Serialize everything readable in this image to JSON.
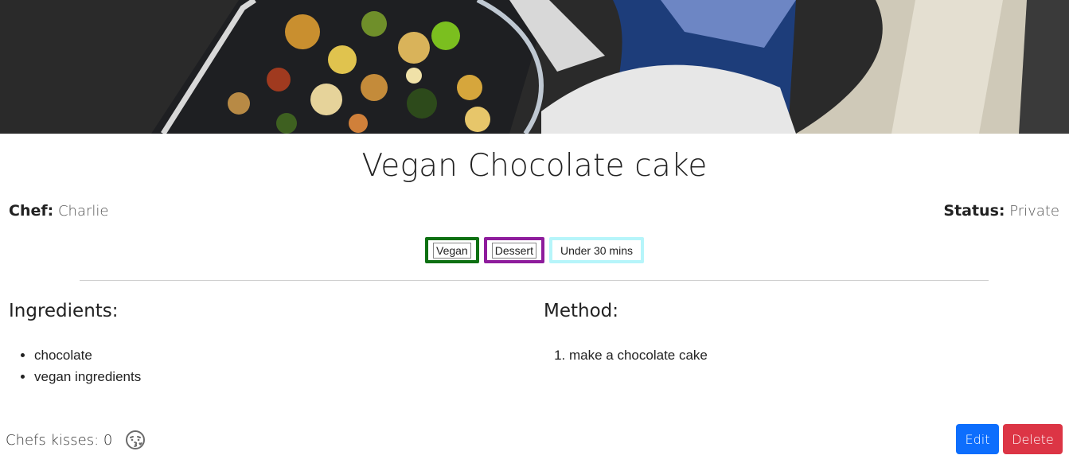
{
  "hero": {
    "image": "cooking-pan-vegetables-photo"
  },
  "recipe": {
    "title": "Vegan Chocolate cake",
    "chef_label": "Chef:",
    "chef": "Charlie",
    "status_label": "Status:",
    "status": "Private"
  },
  "tags": [
    {
      "label": "Vegan",
      "color": "#0d7012"
    },
    {
      "label": "Dessert",
      "color": "#8e1c9c"
    },
    {
      "label": "Under 30 mins",
      "color": "#b6f5fa"
    }
  ],
  "ingredients": {
    "heading": "Ingredients:",
    "items": [
      "chocolate",
      "vegan ingredients"
    ]
  },
  "method": {
    "heading": "Method:",
    "steps": [
      "make a chocolate cake"
    ]
  },
  "kisses": {
    "label": "Chefs kisses: 0",
    "icon": "kissing-face-icon"
  },
  "actions": {
    "edit_label": "Edit",
    "edit_color": "#0d6efd",
    "delete_label": "Delete",
    "delete_color": "#dc3545"
  }
}
